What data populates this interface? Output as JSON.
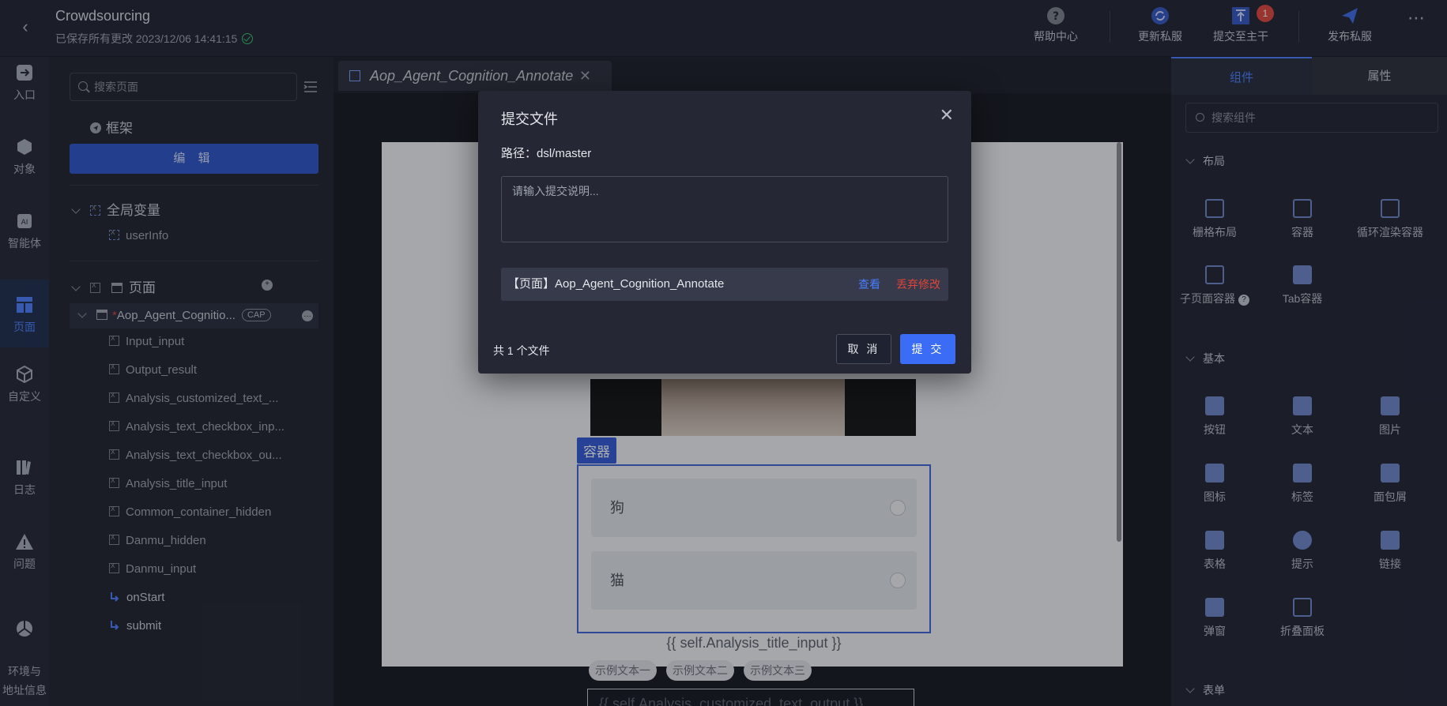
{
  "header": {
    "title": "Crowdsourcing",
    "save_status": "已保存所有更改 2023/12/06 14:41:15",
    "tools": {
      "help": "帮助中心",
      "update": "更新私服",
      "submit_main": "提交至主干",
      "submit_badge": "1",
      "publish": "发布私服"
    }
  },
  "rail": {
    "items": [
      {
        "label": "入口"
      },
      {
        "label": "对象"
      },
      {
        "label": "智能体"
      },
      {
        "label": "页面"
      },
      {
        "label": "自定义"
      },
      {
        "label": "日志"
      },
      {
        "label": "问题"
      },
      {
        "label": "环境与\n地址信息"
      }
    ]
  },
  "leftpanel": {
    "search_placeholder": "搜索页面",
    "frame_label": "框架",
    "edit_label": "编 辑",
    "global_vars_label": "全局变量",
    "global_var_user": "userInfo",
    "pages_label": "页面",
    "current_page": "Aop_Agent_Cognitio...",
    "current_page_tag": "CAP",
    "current_page_star": "*",
    "items": [
      "Input_input",
      "Output_result",
      "Analysis_customized_text_...",
      "Analysis_text_checkbox_inp...",
      "Analysis_text_checkbox_ou...",
      "Analysis_title_input",
      "Common_container_hidden",
      "Danmu_hidden",
      "Danmu_input"
    ],
    "events": [
      "onStart",
      "submit"
    ]
  },
  "tab": {
    "label": "Aop_Agent_Cognition_Annotate"
  },
  "canvas": {
    "container_tag": "容器",
    "options": [
      "狗",
      "猫"
    ],
    "title_expr": "{{ self.Analysis_title_input }}",
    "chips": [
      "示例文本一",
      "示例文本二",
      "示例文本三"
    ],
    "text_output": "{{ self.Analysis_customized_text_output }}"
  },
  "rightpanel": {
    "tab_components": "组件",
    "tab_properties": "属性",
    "search_placeholder": "搜索组件",
    "section_layout": "布局",
    "layout_items": [
      "栅格布局",
      "容器",
      "循环渲染容器",
      "子页面容器",
      "Tab容器"
    ],
    "section_basic": "基本",
    "basic_items": [
      "按钮",
      "文本",
      "图片",
      "图标",
      "标签",
      "面包屑",
      "表格",
      "提示",
      "链接",
      "弹窗",
      "折叠面板"
    ],
    "section_form": "表单"
  },
  "modal": {
    "title": "提交文件",
    "path": "路径：dsl/master",
    "textarea_placeholder": "请输入提交说明...",
    "file_label": "【页面】Aop_Agent_Cognition_Annotate",
    "view_label": "查看",
    "discard_label": "丢弃修改",
    "count_label": "共 1 个文件",
    "cancel_label": "取 消",
    "submit_label": "提 交"
  },
  "colors": {
    "accent": "#3b6cf5",
    "danger": "#e0443b",
    "success": "#3cc46a"
  }
}
